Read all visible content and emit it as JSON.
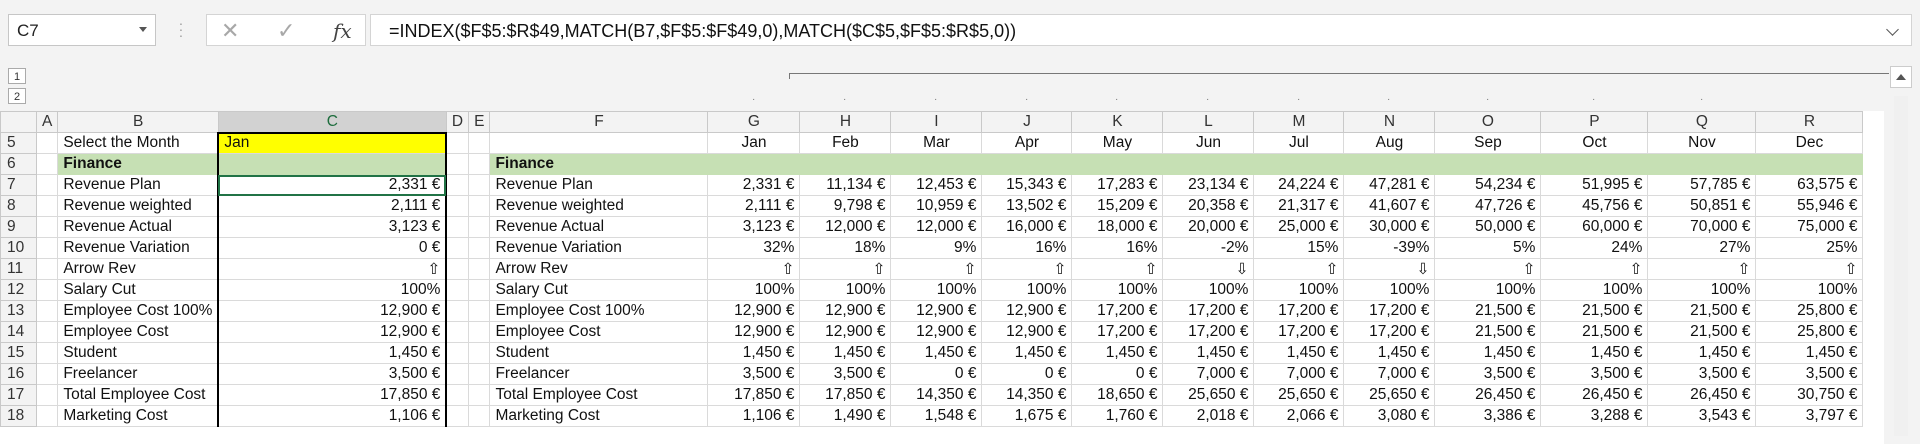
{
  "formula_bar": {
    "name_box": "C7",
    "formula": "=INDEX($F$5:$R$49,MATCH(B7,$F$5:$F$49,0),MATCH($C$5,$F$5:$R$5,0))"
  },
  "outline_levels": [
    "1",
    "2"
  ],
  "columns": [
    "A",
    "B",
    "C",
    "D",
    "E",
    "F",
    "G",
    "H",
    "I",
    "J",
    "K",
    "L",
    "M",
    "N",
    "O",
    "P",
    "Q",
    "R"
  ],
  "months": [
    "Jan",
    "Feb",
    "Mar",
    "Apr",
    "May",
    "Jun",
    "Jul",
    "Aug",
    "Sep",
    "Oct",
    "Nov",
    "Dec"
  ],
  "selector": {
    "label": "Select the Month",
    "value": "Jan"
  },
  "section_title": "Finance",
  "rows": [
    {
      "num": "7",
      "label": "Revenue Plan",
      "c": "2,331 €",
      "values": [
        "2,331 €",
        "11,134 €",
        "12,453 €",
        "15,343 €",
        "17,283 €",
        "23,134 €",
        "24,224 €",
        "47,281 €",
        "54,234 €",
        "51,995 €",
        "57,785 €",
        "63,575 €"
      ]
    },
    {
      "num": "8",
      "label": "Revenue weighted",
      "c": "2,111 €",
      "values": [
        "2,111 €",
        "9,798 €",
        "10,959 €",
        "13,502 €",
        "15,209 €",
        "20,358 €",
        "21,317 €",
        "41,607 €",
        "47,726 €",
        "45,756 €",
        "50,851 €",
        "55,946 €"
      ]
    },
    {
      "num": "9",
      "label": "Revenue  Actual",
      "c": "3,123 €",
      "values": [
        "3,123 €",
        "12,000 €",
        "12,000 €",
        "16,000 €",
        "18,000 €",
        "20,000 €",
        "25,000 €",
        "30,000 €",
        "50,000 €",
        "60,000 €",
        "70,000 €",
        "75,000 €"
      ]
    },
    {
      "num": "10",
      "label": "Revenue Variation",
      "c": "0 €",
      "values": [
        "32%",
        "18%",
        "9%",
        "16%",
        "16%",
        "-2%",
        "15%",
        "-39%",
        "5%",
        "24%",
        "27%",
        "25%"
      ]
    },
    {
      "num": "11",
      "label": "Arrow Rev",
      "c": "⇧",
      "values": [
        "⇧",
        "⇧",
        "⇧",
        "⇧",
        "⇧",
        "⇩",
        "⇧",
        "⇩",
        "⇧",
        "⇧",
        "⇧",
        "⇧"
      ]
    },
    {
      "num": "12",
      "label": "Salary Cut",
      "c": "100%",
      "values": [
        "100%",
        "100%",
        "100%",
        "100%",
        "100%",
        "100%",
        "100%",
        "100%",
        "100%",
        "100%",
        "100%",
        "100%"
      ]
    },
    {
      "num": "13",
      "label": "Employee Cost 100%",
      "c": "12,900 €",
      "values": [
        "12,900 €",
        "12,900 €",
        "12,900 €",
        "12,900 €",
        "17,200 €",
        "17,200 €",
        "17,200 €",
        "17,200 €",
        "21,500 €",
        "21,500 €",
        "21,500 €",
        "25,800 €"
      ]
    },
    {
      "num": "14",
      "label": "Employee Cost",
      "c": "12,900 €",
      "values": [
        "12,900 €",
        "12,900 €",
        "12,900 €",
        "12,900 €",
        "17,200 €",
        "17,200 €",
        "17,200 €",
        "17,200 €",
        "21,500 €",
        "21,500 €",
        "21,500 €",
        "25,800 €"
      ]
    },
    {
      "num": "15",
      "label": "Student",
      "c": "1,450 €",
      "values": [
        "1,450 €",
        "1,450 €",
        "1,450 €",
        "1,450 €",
        "1,450 €",
        "1,450 €",
        "1,450 €",
        "1,450 €",
        "1,450 €",
        "1,450 €",
        "1,450 €",
        "1,450 €"
      ]
    },
    {
      "num": "16",
      "label": "Freelancer",
      "c": "3,500 €",
      "values": [
        "3,500 €",
        "3,500 €",
        "0 €",
        "0 €",
        "0 €",
        "7,000 €",
        "7,000 €",
        "7,000 €",
        "3,500 €",
        "3,500 €",
        "3,500 €",
        "3,500 €"
      ]
    },
    {
      "num": "17",
      "label": "Total Employee Cost",
      "c": "17,850 €",
      "values": [
        "17,850 €",
        "17,850 €",
        "14,350 €",
        "14,350 €",
        "18,650 €",
        "25,650 €",
        "25,650 €",
        "25,650 €",
        "26,450 €",
        "26,450 €",
        "26,450 €",
        "30,750 €"
      ]
    },
    {
      "num": "18",
      "label": "Marketing Cost",
      "c": "1,106 €",
      "values": [
        "1,106 €",
        "1,490 €",
        "1,548 €",
        "1,675 €",
        "1,760 €",
        "2,018 €",
        "2,066 €",
        "3,080 €",
        "3,386 €",
        "3,288 €",
        "3,543 €",
        "3,797 €"
      ]
    }
  ]
}
